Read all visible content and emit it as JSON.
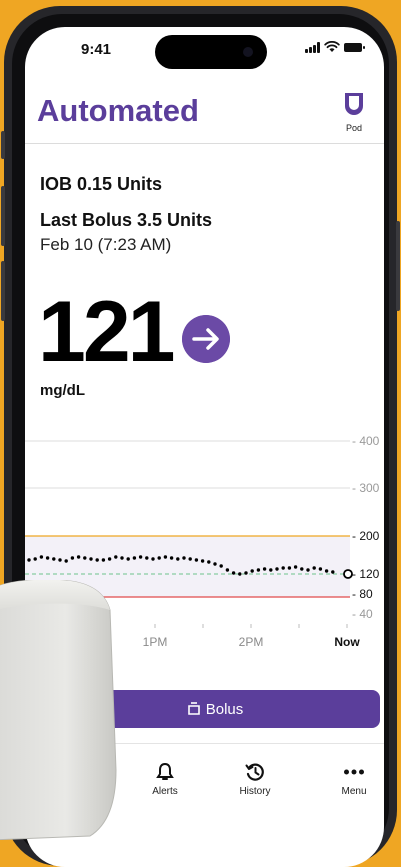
{
  "status_bar": {
    "time": "9:41"
  },
  "header": {
    "title": "Automated",
    "pod_label": "Pod"
  },
  "summary": {
    "iob": "IOB 0.15 Units",
    "last_bolus": "Last Bolus 3.5 Units",
    "last_bolus_time": "Feb 10 (7:23 AM)"
  },
  "glucose": {
    "value": "121",
    "unit": "mg/dL",
    "trend": "steady"
  },
  "chart": {
    "y_labels": [
      "- 400",
      "- 300",
      "- 200",
      "- 120",
      "- 80",
      "- 40"
    ],
    "x_labels": [
      "1PM",
      "2PM",
      "Now"
    ],
    "colors": {
      "high_line": "#EFA623",
      "low_line": "#E04B4B",
      "target_line": "#6cc38c",
      "dots": "#000000"
    }
  },
  "bolus_button": {
    "label": "Bolus"
  },
  "tabs": [
    {
      "label": "Alerts",
      "icon": "bell-icon"
    },
    {
      "label": "History",
      "icon": "history-icon"
    },
    {
      "label": "Menu",
      "icon": "more-icon"
    }
  ],
  "colors": {
    "accent": "#5B3E9B",
    "background": "#EFA623"
  }
}
